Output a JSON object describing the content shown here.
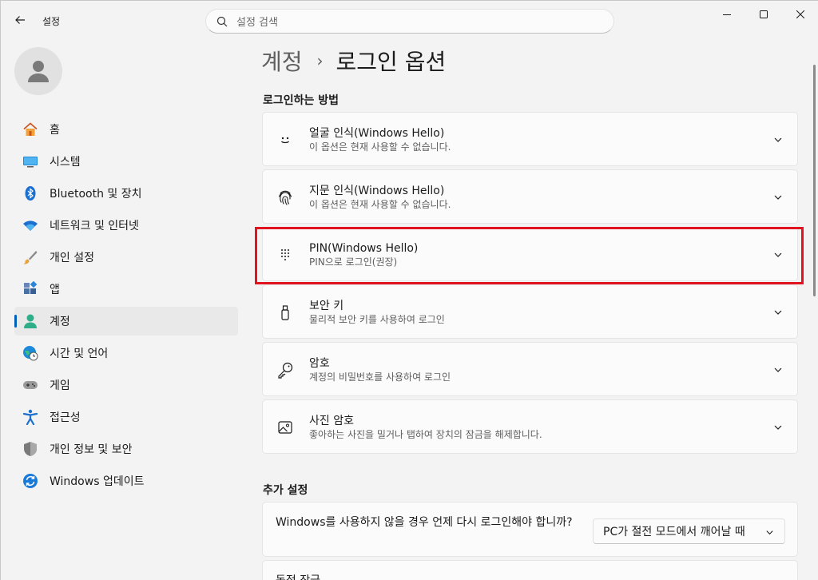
{
  "titlebar": {
    "app_title": "설정",
    "search_placeholder": "설정 검색"
  },
  "sidebar": {
    "items": [
      {
        "label": "홈",
        "icon": "home-icon"
      },
      {
        "label": "시스템",
        "icon": "system-icon"
      },
      {
        "label": "Bluetooth 및 장치",
        "icon": "bluetooth-icon"
      },
      {
        "label": "네트워크 및 인터넷",
        "icon": "wifi-icon"
      },
      {
        "label": "개인 설정",
        "icon": "brush-icon"
      },
      {
        "label": "앱",
        "icon": "apps-icon"
      },
      {
        "label": "계정",
        "icon": "account-icon",
        "active": true
      },
      {
        "label": "시간 및 언어",
        "icon": "globe-clock-icon"
      },
      {
        "label": "게임",
        "icon": "gamepad-icon"
      },
      {
        "label": "접근성",
        "icon": "accessibility-icon"
      },
      {
        "label": "개인 정보 및 보안",
        "icon": "shield-icon"
      },
      {
        "label": "Windows 업데이트",
        "icon": "update-icon"
      }
    ]
  },
  "main": {
    "breadcrumb_parent": "계정",
    "breadcrumb_sep": "›",
    "breadcrumb_current": "로그인 옵션",
    "signin_section_title": "로그인하는 방법",
    "signin_options": [
      {
        "title": "얼굴 인식(Windows Hello)",
        "desc": "이 옵션은 현재 사용할 수 없습니다.",
        "icon": "face-icon"
      },
      {
        "title": "지문 인식(Windows Hello)",
        "desc": "이 옵션은 현재 사용할 수 없습니다.",
        "icon": "fingerprint-icon"
      },
      {
        "title": "PIN(Windows Hello)",
        "desc": "PIN으로 로그인(권장)",
        "icon": "pin-keypad-icon"
      },
      {
        "title": "보안 키",
        "desc": "물리적 보안 키를 사용하여 로그인",
        "icon": "usb-key-icon"
      },
      {
        "title": "암호",
        "desc": "계정의 비밀번호를 사용하여 로그인",
        "icon": "key-icon"
      },
      {
        "title": "사진 암호",
        "desc": "좋아하는 사진을 밀거나 탭하여 장치의 잠금을 해제합니다.",
        "icon": "picture-icon"
      }
    ],
    "extra_section_title": "추가 설정",
    "extra_setting_text": "Windows를 사용하지 않을 경우 언제 다시 로그인해야 합니까?",
    "extra_setting_value": "PC가 절전 모드에서 깨어날 때",
    "cutoff_text": "동적 잠금"
  },
  "colors": {
    "accent": "#005fb8",
    "highlight": "#e0141e"
  }
}
